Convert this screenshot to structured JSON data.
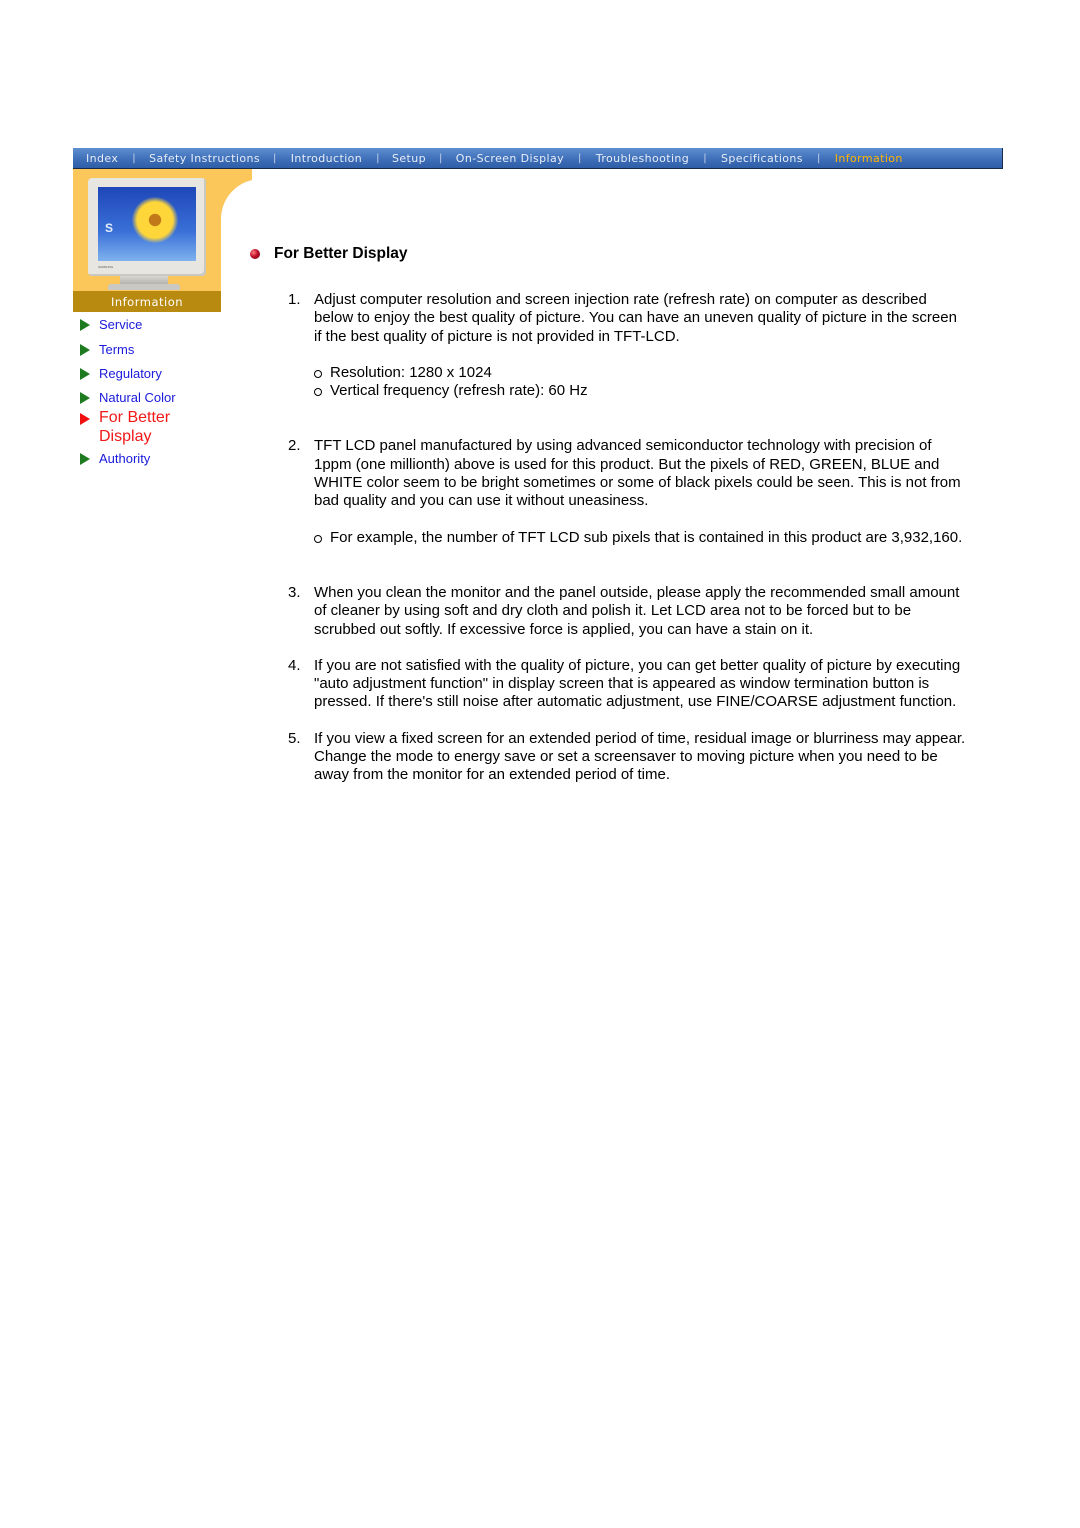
{
  "nav": {
    "items": [
      {
        "label": "Index",
        "active": false
      },
      {
        "label": "Safety Instructions",
        "active": false
      },
      {
        "label": "Introduction",
        "active": false
      },
      {
        "label": "Setup",
        "active": false
      },
      {
        "label": "On-Screen Display",
        "active": false
      },
      {
        "label": "Troubleshooting",
        "active": false
      },
      {
        "label": "Specifications",
        "active": false
      },
      {
        "label": "Information",
        "active": true
      }
    ],
    "separator": "|",
    "active_color": "#ffb400"
  },
  "sidebar": {
    "banner_title": "Information",
    "monitor_logo": "S",
    "monitor_brand": "SAMSUNG",
    "items": [
      {
        "label": "Service",
        "active": false
      },
      {
        "label": "Terms",
        "active": false
      },
      {
        "label": "Regulatory",
        "active": false
      },
      {
        "label": "Natural Color",
        "active": false
      },
      {
        "label": "For Better Display",
        "active": true
      },
      {
        "label": "Authority",
        "active": false
      }
    ]
  },
  "main": {
    "title": "For Better Display",
    "items": [
      {
        "num": "1.",
        "text": "Adjust computer resolution and screen injection rate (refresh rate) on computer as described below to enjoy the best quality of picture. You can have an uneven quality of picture in the screen if the best quality of picture is not provided in TFT-LCD.",
        "sub": [
          "Resolution: 1280 x 1024",
          "Vertical frequency (refresh rate): 60 Hz"
        ]
      },
      {
        "num": "2.",
        "text": "TFT LCD panel manufactured by using advanced semiconductor technology with precision of 1ppm (one millionth) above is used for this product. But the pixels of RED, GREEN, BLUE and WHITE color seem to be bright sometimes or some of black pixels could be seen. This is not from bad quality and you can use it without uneasiness.",
        "sub": [
          "For example, the number of TFT LCD sub pixels that is contained in this product are 3,932,160."
        ]
      },
      {
        "num": "3.",
        "text": "When you clean the monitor and the panel outside, please apply the recommended small amount of cleaner by using soft and dry cloth and polish it. Let LCD area not to be forced but to be scrubbed out softly. If excessive force is applied, you can have a stain on it.",
        "sub": []
      },
      {
        "num": "4.",
        "text": "If you are not satisfied with the quality of picture, you can get better quality of picture by executing \"auto adjustment function\" in display screen that is appeared as window termination button is pressed. If there's still noise after automatic adjustment, use FINE/COARSE adjustment function.",
        "sub": []
      },
      {
        "num": "5.",
        "text": "If you view a fixed screen for an extended period of time, residual image or blurriness may appear.",
        "text2": "Change the mode to energy save or set a screensaver to moving picture when you need to be away from the monitor for an extended period of time.",
        "sub": []
      }
    ]
  }
}
